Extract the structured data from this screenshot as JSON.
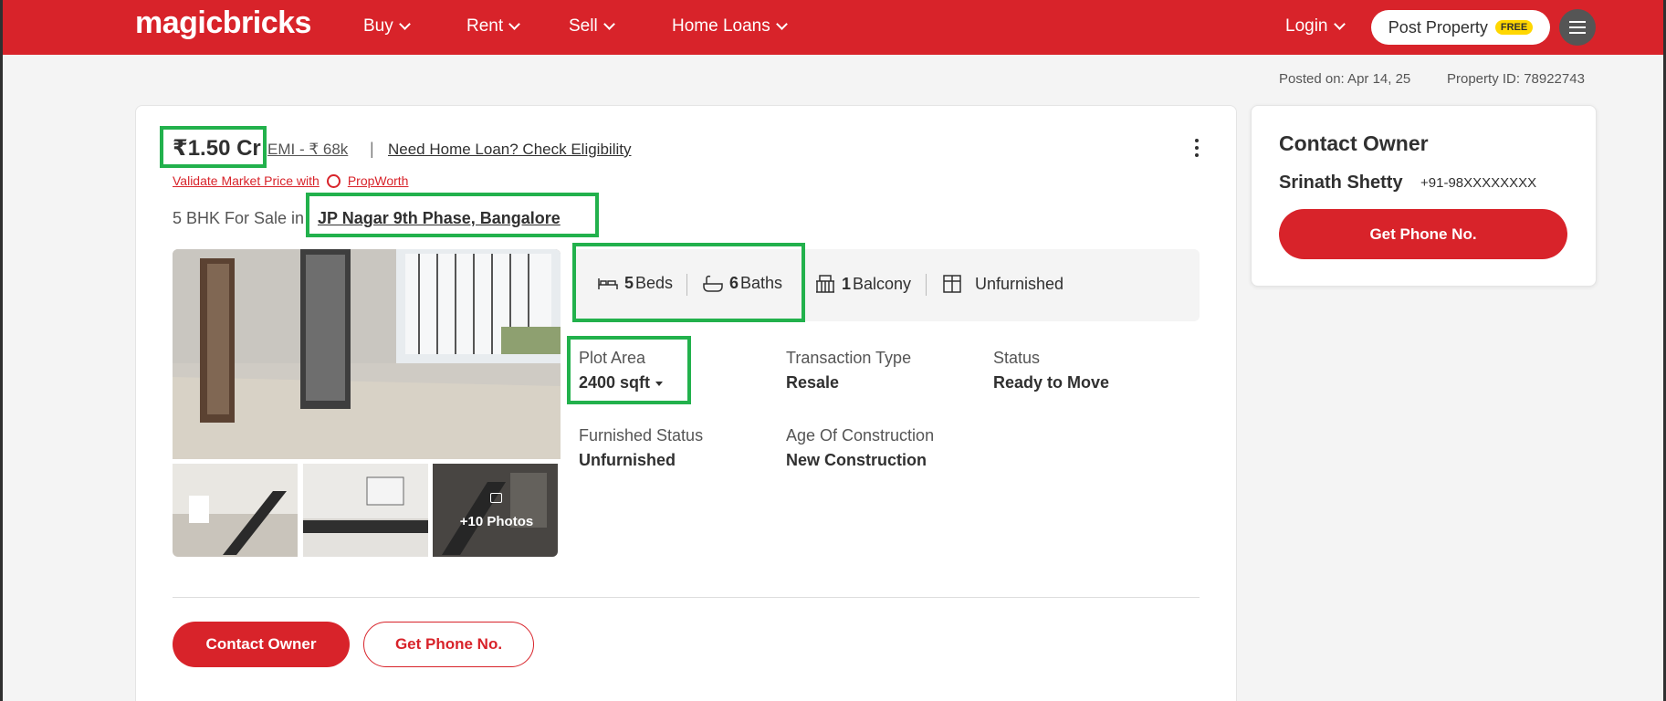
{
  "header": {
    "logo": "magicbricks",
    "nav": [
      {
        "label": "Buy"
      },
      {
        "label": "Rent"
      },
      {
        "label": "Sell"
      },
      {
        "label": "Home Loans"
      }
    ],
    "login": "Login",
    "post_property": "Post Property",
    "free_badge": "FREE"
  },
  "meta": {
    "posted_on": "Posted on: Apr 14, 25",
    "property_id": "Property ID: 78922743"
  },
  "listing": {
    "price": "₹1.50 Cr",
    "emi": "EMI - ₹ 68k",
    "separator": "|",
    "home_loan_link": "Need Home Loan? Check Eligibility",
    "validate_text": "Validate Market Price with",
    "propworth": "PropWorth",
    "title_prefix": "5 BHK For Sale in",
    "location": "JP Nagar 9th Phase, Bangalore",
    "photos_more": "+10 Photos",
    "amenities": {
      "beds_count": "5",
      "beds_label": "Beds",
      "baths_count": "6",
      "baths_label": "Baths",
      "balcony_count": "1",
      "balcony_label": "Balcony",
      "furnishing": "Unfurnished"
    },
    "summary": {
      "plot_area_label": "Plot Area",
      "plot_area_value": "2400 sqft",
      "transaction_label": "Transaction Type",
      "transaction_value": "Resale",
      "status_label": "Status",
      "status_value": "Ready to Move",
      "furnished_label": "Furnished Status",
      "furnished_value": "Unfurnished",
      "age_label": "Age Of Construction",
      "age_value": "New Construction"
    },
    "buttons": {
      "contact_owner": "Contact Owner",
      "get_phone": "Get Phone No."
    }
  },
  "contact_card": {
    "title": "Contact Owner",
    "owner_name": "Srinath Shetty",
    "phone": "+91-98XXXXXXXX",
    "button": "Get Phone No."
  },
  "colors": {
    "brand_red": "#d8232a",
    "highlight_green": "#22b14c",
    "free_badge": "#ffd700"
  }
}
